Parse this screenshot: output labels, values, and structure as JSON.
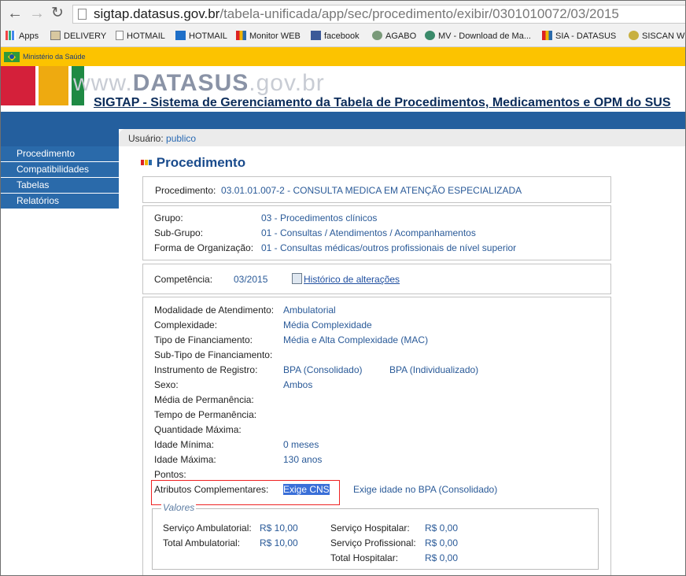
{
  "browser": {
    "url_host": "sigtap.datasus.gov.br",
    "url_path": "/tabela-unificada/app/sec/procedimento/exibir/0301010072/03/2015",
    "bookmarks": [
      "Apps",
      "DELIVERY",
      "HOTMAIL",
      "HOTMAIL",
      "Monitor WEB",
      "facebook",
      "AGABO",
      "MV - Download de Ma...",
      "SIA - DATASUS",
      "SISCAN WE"
    ]
  },
  "ministry": "Ministério da Saúde",
  "header": {
    "watermark_pre": "www.",
    "watermark_strong": "DATASUS",
    "watermark_post": ".gov.br",
    "system_title": "SIGTAP - Sistema de Gerenciamento da Tabela de Procedimentos, Medicamentos e OPM do SUS"
  },
  "user": {
    "label": "Usuário:",
    "name": "publico"
  },
  "menu": [
    "Procedimento",
    "Compatibilidades",
    "Tabelas",
    "Relatórios"
  ],
  "page_title": "Procedimento",
  "procedure": {
    "label": "Procedimento:",
    "value": "03.01.01.007-2 - CONSULTA MEDICA EM ATENÇÃO ESPECIALIZADA"
  },
  "classification": [
    {
      "label": "Grupo:",
      "value": "03 - Procedimentos clínicos"
    },
    {
      "label": "Sub-Grupo:",
      "value": "01 - Consultas / Atendimentos / Acompanhamentos"
    },
    {
      "label": "Forma de Organização:",
      "value": "01 - Consultas médicas/outros profissionais de nível superior"
    }
  ],
  "competencia": {
    "label": "Competência:",
    "value": "03/2015",
    "history_link": "Histórico de alterações"
  },
  "details": [
    {
      "label": "Modalidade de Atendimento:",
      "value": "Ambulatorial",
      "value2": ""
    },
    {
      "label": "Complexidade:",
      "value": "Média Complexidade",
      "value2": ""
    },
    {
      "label": "Tipo de Financiamento:",
      "value": "Média e Alta Complexidade (MAC)",
      "value2": ""
    },
    {
      "label": "Sub-Tipo de Financiamento:",
      "value": "",
      "value2": ""
    },
    {
      "label": "Instrumento de Registro:",
      "value": "BPA (Consolidado)",
      "value2": "BPA (Individualizado)"
    },
    {
      "label": "Sexo:",
      "value": "Ambos",
      "value2": ""
    },
    {
      "label": "Média de Permanência:",
      "value": "",
      "value2": ""
    },
    {
      "label": "Tempo de Permanência:",
      "value": "",
      "value2": ""
    },
    {
      "label": "Quantidade Máxima:",
      "value": "",
      "value2": ""
    },
    {
      "label": "Idade Mínima:",
      "value": "0 meses",
      "value2": ""
    },
    {
      "label": "Idade Máxima:",
      "value": "130 anos",
      "value2": ""
    },
    {
      "label": "Pontos:",
      "value": "",
      "value2": ""
    }
  ],
  "atributos": {
    "label": "Atributos Complementares:",
    "value1": "Exige CNS",
    "value2": "Exige idade no BPA (Consolidado)"
  },
  "valores": {
    "legend": "Valores",
    "left": [
      {
        "label": "Serviço Ambulatorial:",
        "value": "R$ 10,00"
      },
      {
        "label": "Total Ambulatorial:",
        "value": "R$ 10,00"
      }
    ],
    "right": [
      {
        "label": "Serviço Hospitalar:",
        "value": "R$ 0,00"
      },
      {
        "label": "Serviço Profissional:",
        "value": "R$ 0,00"
      },
      {
        "label": "Total Hospitalar:",
        "value": "R$ 0,00"
      }
    ]
  }
}
